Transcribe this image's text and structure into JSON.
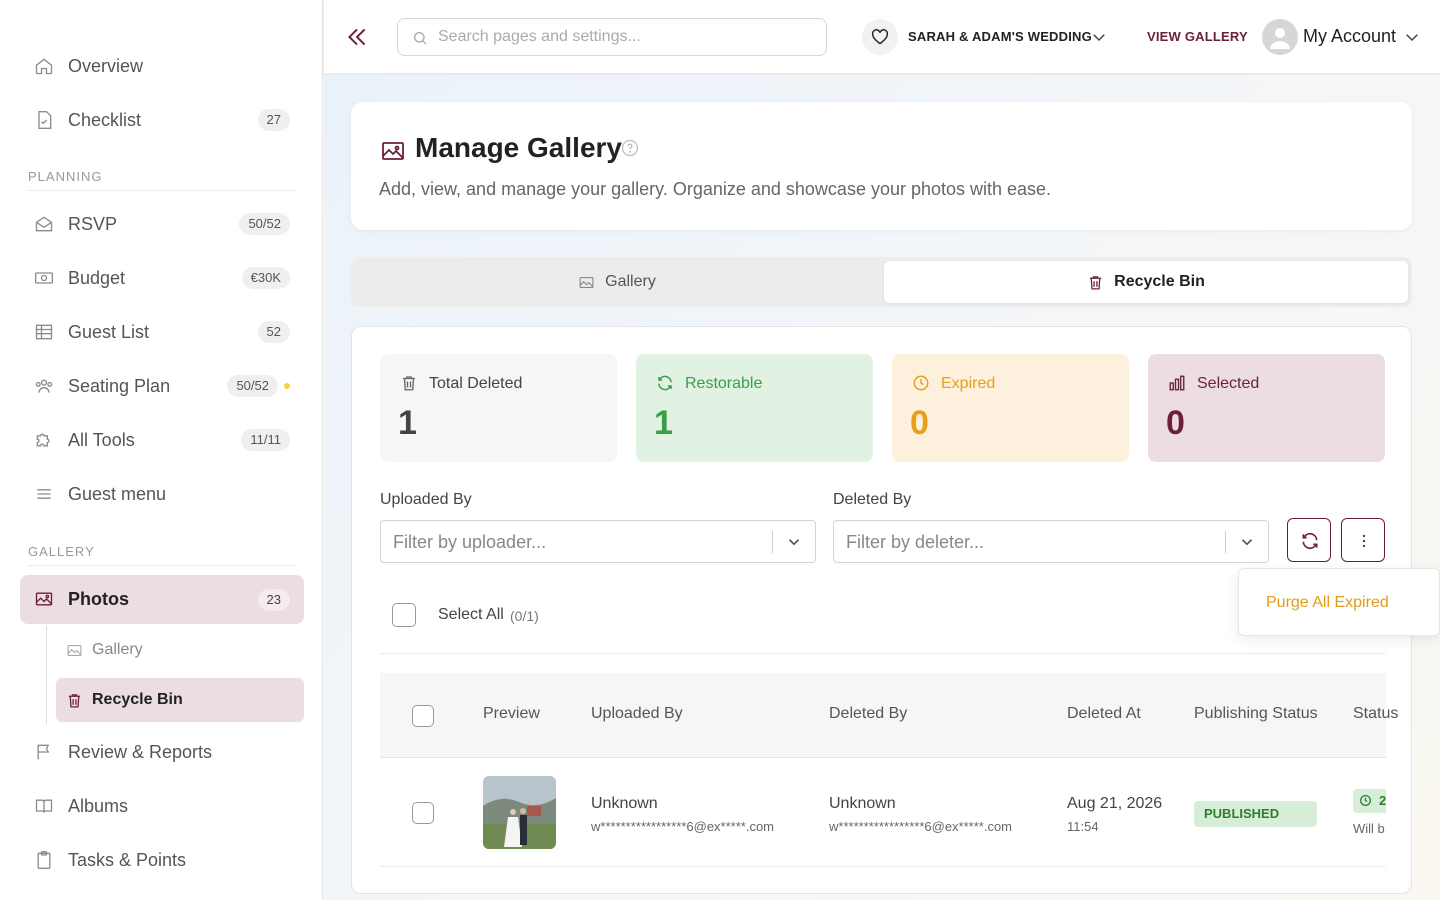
{
  "sidebar": {
    "items": [
      {
        "label": "Overview",
        "badge": ""
      },
      {
        "label": "Checklist",
        "badge": "27"
      }
    ],
    "section_planning": "PLANNING",
    "planning_items": [
      {
        "label": "RSVP",
        "badge": "50/52"
      },
      {
        "label": "Budget",
        "badge": "€30K"
      },
      {
        "label": "Guest List",
        "badge": "52"
      },
      {
        "label": "Seating Plan",
        "badge": "50/52"
      },
      {
        "label": "All Tools",
        "badge": "11/11"
      },
      {
        "label": "Guest menu",
        "badge": ""
      }
    ],
    "section_gallery": "GALLERY",
    "photos": {
      "label": "Photos",
      "badge": "23"
    },
    "sub_items": [
      {
        "label": "Gallery"
      },
      {
        "label": "Recycle Bin"
      }
    ],
    "bottom_items": [
      {
        "label": "Review & Reports"
      },
      {
        "label": "Albums"
      },
      {
        "label": "Tasks & Points"
      }
    ]
  },
  "topbar": {
    "search_placeholder": "Search pages and settings...",
    "wedding_name": "SARAH & ADAM'S WEDDING",
    "view_gallery": "VIEW GALLERY",
    "account": "My Account"
  },
  "header": {
    "title": "Manage Gallery",
    "description": "Add, view, and manage your gallery. Organize and showcase your photos with ease."
  },
  "tabs": [
    {
      "label": "Gallery"
    },
    {
      "label": "Recycle Bin"
    }
  ],
  "stats": [
    {
      "label": "Total Deleted",
      "value": "1"
    },
    {
      "label": "Restorable",
      "value": "1"
    },
    {
      "label": "Expired",
      "value": "0"
    },
    {
      "label": "Selected",
      "value": "0"
    }
  ],
  "filters": {
    "uploaded_by_label": "Uploaded By",
    "uploaded_by_placeholder": "Filter by uploader...",
    "deleted_by_label": "Deleted By",
    "deleted_by_placeholder": "Filter by deleter..."
  },
  "select_all": {
    "label": "Select All",
    "count": "(0/1)"
  },
  "menu": {
    "purge_all_expired": "Purge All Expired"
  },
  "table": {
    "columns": [
      "Preview",
      "Uploaded By",
      "Deleted By",
      "Deleted At",
      "Publishing Status",
      "Status"
    ],
    "rows": [
      {
        "uploaded_by": "Unknown",
        "uploaded_by_email": "w*****************6@ex*****.com",
        "deleted_by": "Unknown",
        "deleted_by_email": "w*****************6@ex*****.com",
        "deleted_date": "Aug 21, 2026",
        "deleted_time": "11:54",
        "publishing_status": "PUBLISHED",
        "status": "2",
        "status_note": "Will b"
      }
    ]
  },
  "colors": {
    "brand": "#6b1f3b",
    "active_bg": "#ebdde2",
    "restorable": "#3a9d47",
    "expired": "#e6a01a",
    "selected": "#6b1f3b",
    "published": "#2e7d32"
  }
}
